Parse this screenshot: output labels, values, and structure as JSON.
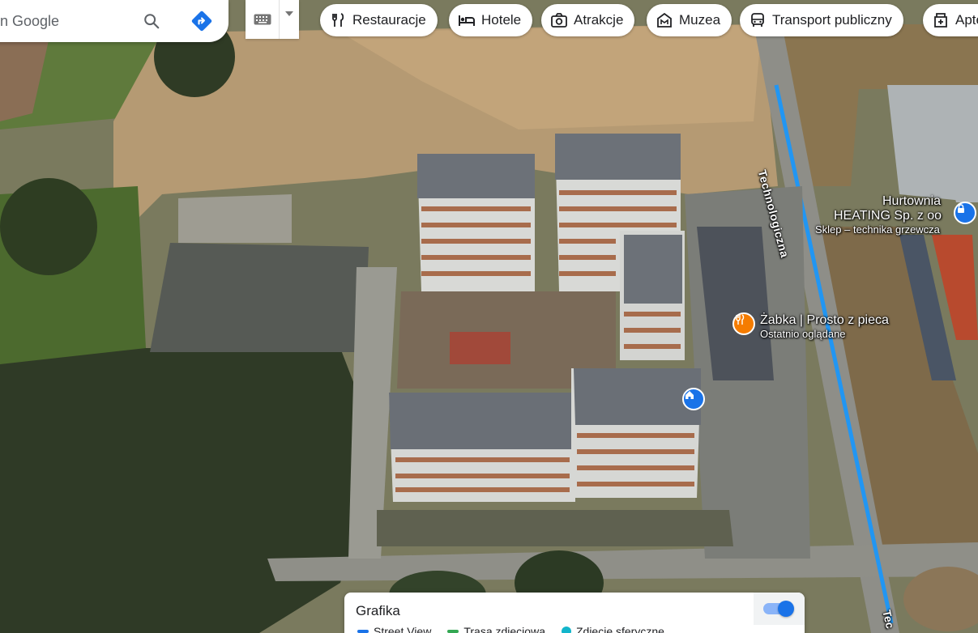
{
  "search": {
    "placeholder": "n Google"
  },
  "chips": [
    {
      "label": "Restauracje",
      "icon": "fork-knife-icon"
    },
    {
      "label": "Hotele",
      "icon": "bed-icon"
    },
    {
      "label": "Atrakcje",
      "icon": "camera-icon"
    },
    {
      "label": "Muzea",
      "icon": "museum-icon"
    },
    {
      "label": "Transport publiczny",
      "icon": "bus-icon"
    },
    {
      "label": "Apte",
      "icon": "pharmacy-icon"
    }
  ],
  "map": {
    "street_label": "Technologiczna",
    "street_label_bottom": "Tec",
    "places": [
      {
        "name": "Hurtownia",
        "name2": "HEATING Sp. z oo",
        "sub": "Sklep – technika grzewcza",
        "icon": "shop-lock-icon"
      },
      {
        "name": "Żabka | Prosto z pieca",
        "sub": "Ostatnio oglądane",
        "icon": "restaurant-pin-icon"
      }
    ],
    "home_icon": "home-pin-icon"
  },
  "layers": {
    "title": "Grafika",
    "toggle_on": true,
    "options": [
      {
        "label": "Street View",
        "color": "#1a73e8"
      },
      {
        "label": "Trasa zdjęciowa",
        "color": "#34a853"
      },
      {
        "label": "Zdjęcie sferyczne",
        "color": "#12b5cb"
      }
    ]
  },
  "colors": {
    "accent": "#1a73e8",
    "restaurant_pin": "#f57c00",
    "street_line": "#2196f3"
  }
}
